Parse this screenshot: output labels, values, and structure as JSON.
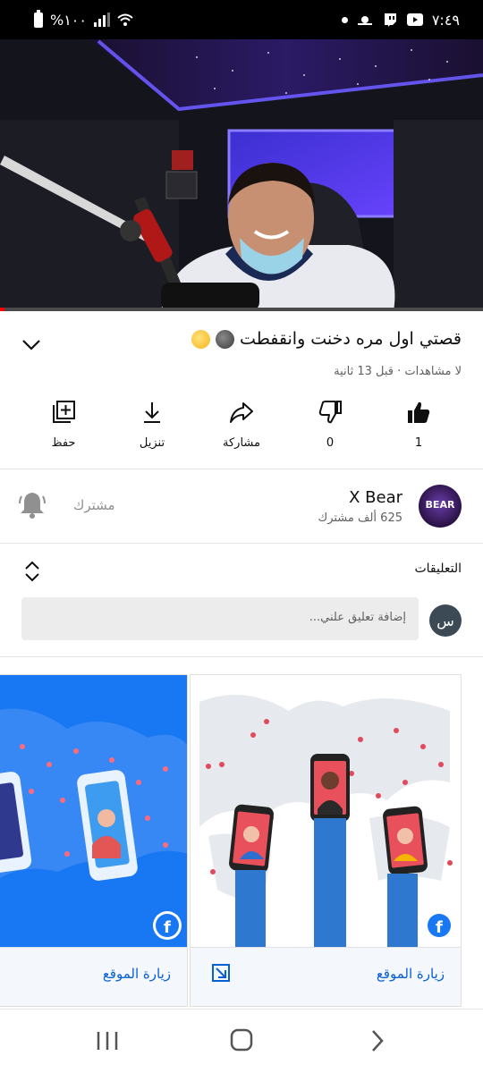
{
  "status_bar": {
    "time": "٧:٤٩",
    "battery_text": "%١٠٠"
  },
  "video": {
    "progress_fraction": 0.01
  },
  "title": {
    "text": "قصتي اول مره دخنت وانقفطت",
    "emoji": [
      "dark-face-emoji",
      "laughing-face-emoji"
    ],
    "meta": "لا مشاهدات · قبل 13 ثانية"
  },
  "actions": {
    "like_count": "1",
    "dislike_count": "0",
    "share_label": "مشاركة",
    "download_label": "تنزيل",
    "save_label": "حفظ"
  },
  "channel": {
    "name": "X Bear",
    "subscribers": "625 ألف مشترك",
    "avatar_text": "BEAR",
    "subscribed_label": "مشترك"
  },
  "comments": {
    "title": "التعليقات",
    "avatar_letter": "س",
    "placeholder": "إضافة تعليق علني..."
  },
  "ads": {
    "card1_cta": "زيارة الموقع",
    "card2_cta": "زيارة الموقع",
    "brand_icon": "facebook-icon"
  },
  "colors": {
    "accent_red": "#ff0000",
    "link_blue": "#065fd4",
    "facebook_blue": "#1877f2"
  }
}
